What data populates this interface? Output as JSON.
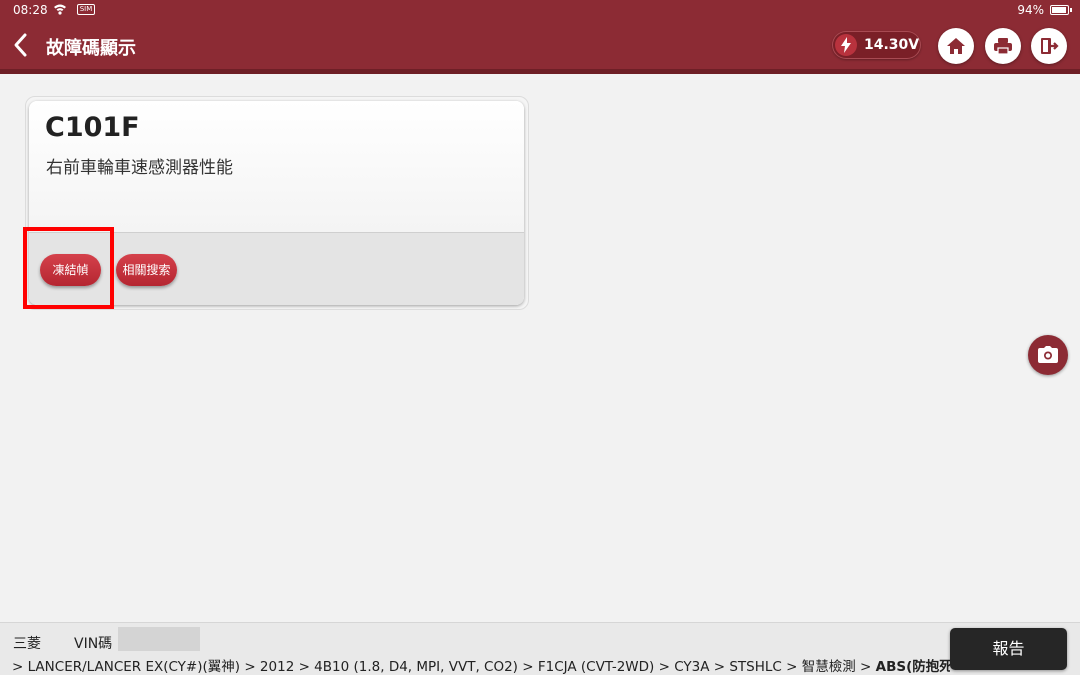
{
  "status_bar": {
    "time": "08:28",
    "sim_label": "SIM",
    "battery_percent": "94%"
  },
  "header": {
    "title": "故障碼顯示",
    "voltage": "14.30V"
  },
  "dtc": {
    "code": "C101F",
    "description": "右前車輪車速感測器性能",
    "buttons": {
      "freeze_frame": "凍結幀",
      "related_search": "相關搜索"
    }
  },
  "footer": {
    "make": "三菱",
    "vin_label": "VIN碼",
    "vin_value": "",
    "path": "> LANCER/LANCER EX(CY#)(翼神) > 2012 > 4B10 (1.8, D4, MPI, VVT, CO2) > F1CJA (CVT-2WD) > CY3A > STSHLC > 智慧檢測 >",
    "path_last": "ABS(防抱死",
    "report_label": "報告"
  },
  "colors": {
    "brand": "#8c2b34",
    "button_red": "#c5323c",
    "highlight": "#ff0000"
  },
  "icons": [
    "back-icon",
    "bolt-icon",
    "home-icon",
    "print-icon",
    "exit-icon",
    "camera-icon",
    "wifi-icon",
    "battery-icon"
  ]
}
